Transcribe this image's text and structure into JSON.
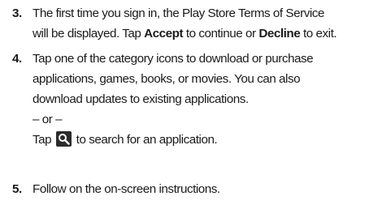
{
  "steps": [
    {
      "number": "3.",
      "lines": [
        {
          "text": "The first time you sign in, the Play Store Terms of Service"
        },
        {
          "pre": "will be displayed. Tap ",
          "bold1": "Accept",
          "mid": " to continue or ",
          "bold2": "Decline",
          "post": " to exit."
        }
      ]
    },
    {
      "number": "4.",
      "lines": [
        {
          "text": "Tap one of the category icons to download or purchase"
        },
        {
          "text": "applications, games, books, or movies. You can also"
        },
        {
          "text": "download updates to existing applications."
        },
        {
          "text": "– or –"
        },
        {
          "pre": "Tap ",
          "icon": "search-icon",
          "post": " to search for an application."
        }
      ]
    },
    {
      "number": "5.",
      "lines": [
        {
          "text": "Follow on the on-screen instructions."
        }
      ]
    }
  ]
}
